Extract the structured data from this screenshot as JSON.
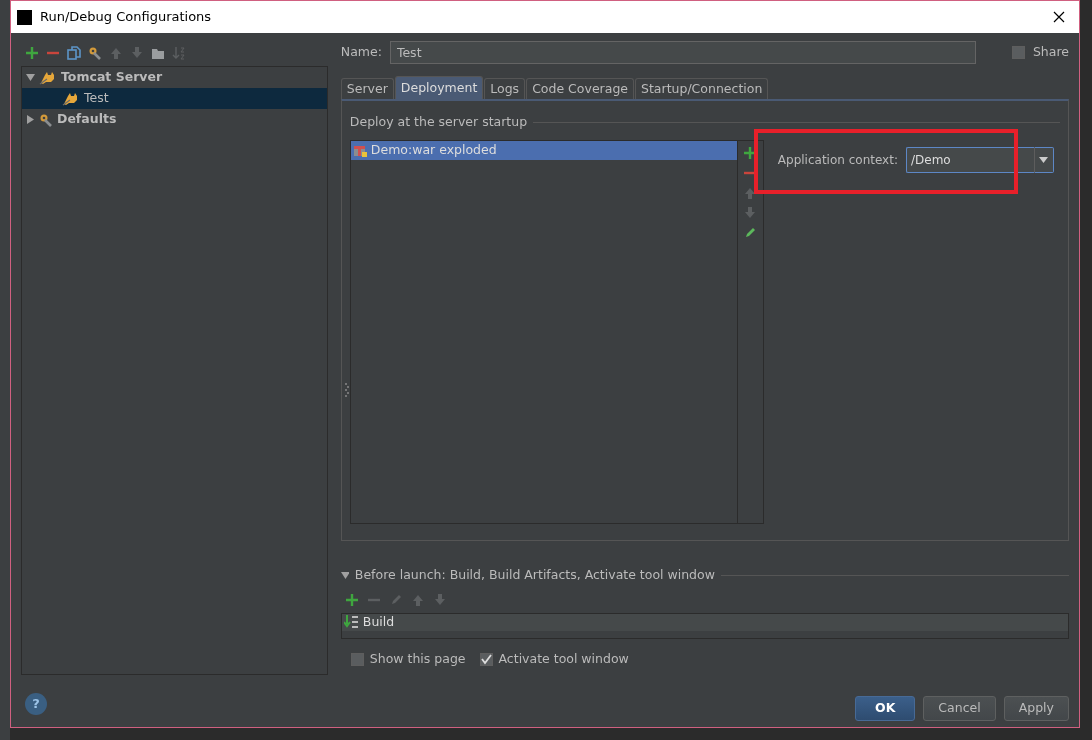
{
  "window": {
    "title": "Run/Debug Configurations"
  },
  "toolbar": [
    {
      "kind": "add",
      "disabled": false
    },
    {
      "kind": "remove",
      "disabled": false
    },
    {
      "kind": "copy",
      "disabled": false
    },
    {
      "kind": "wrench",
      "disabled": false
    },
    {
      "kind": "up",
      "disabled": true
    },
    {
      "kind": "down",
      "disabled": true
    },
    {
      "kind": "folder",
      "disabled": false
    },
    {
      "kind": "sort",
      "disabled": true
    }
  ],
  "tree": [
    {
      "label": "Tomcat Server",
      "kind": "server",
      "expanded": true,
      "selected": false,
      "children": [
        {
          "label": "Test",
          "kind": "server",
          "selected": true
        }
      ]
    },
    {
      "label": "Defaults",
      "kind": "defaults",
      "expanded": false,
      "selected": false
    }
  ],
  "name_field": {
    "label": "Name:",
    "value": "Test"
  },
  "share": {
    "label": "Share",
    "checked": false
  },
  "tabs": [
    {
      "label": "Server",
      "selected": false
    },
    {
      "label": "Deployment",
      "selected": true
    },
    {
      "label": "Logs",
      "selected": false
    },
    {
      "label": "Code Coverage",
      "selected": false
    },
    {
      "label": "Startup/Connection",
      "selected": false
    }
  ],
  "deployment": {
    "section": "Deploy at the server startup",
    "artifacts": [
      {
        "label": "Demo:war exploded",
        "selected": true
      }
    ],
    "side_tools": [
      {
        "kind": "add",
        "disabled": false
      },
      {
        "kind": "remove",
        "disabled": false
      },
      {
        "kind": "up",
        "disabled": true
      },
      {
        "kind": "down",
        "disabled": true
      },
      {
        "kind": "edit",
        "disabled": false
      }
    ],
    "context": {
      "label": "Application context:",
      "value": "/Demo",
      "highlighted": true
    }
  },
  "before_launch": {
    "title": "Before launch: Build, Build Artifacts, Activate tool window",
    "expanded": true,
    "tools": [
      {
        "kind": "add",
        "disabled": false
      },
      {
        "kind": "remove",
        "disabled": true
      },
      {
        "kind": "edit",
        "disabled": true
      },
      {
        "kind": "up",
        "disabled": true
      },
      {
        "kind": "down",
        "disabled": true
      }
    ],
    "tasks": [
      {
        "label": "Build",
        "selected": true
      }
    ]
  },
  "options": [
    {
      "label": "Show this page",
      "checked": false
    },
    {
      "label": "Activate tool window",
      "checked": true
    }
  ],
  "help": "?",
  "buttons": [
    {
      "label": "OK",
      "default": true
    },
    {
      "label": "Cancel",
      "default": false
    },
    {
      "label": "Apply",
      "default": false
    }
  ]
}
